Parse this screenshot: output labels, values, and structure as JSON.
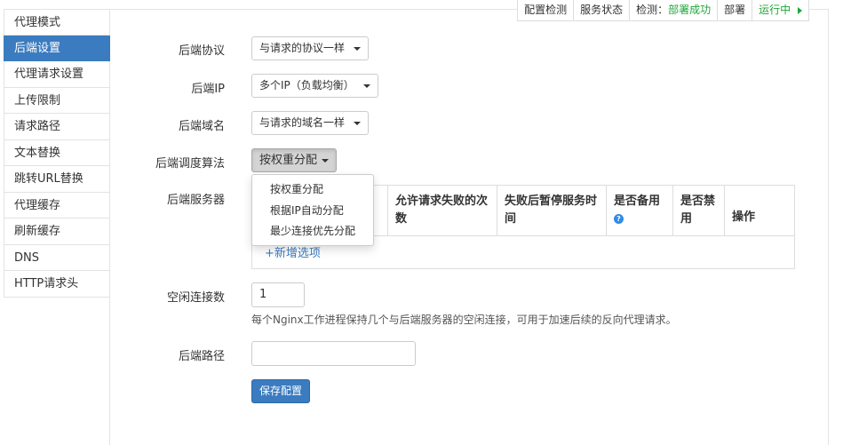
{
  "sidebar": {
    "items": [
      {
        "label": "代理模式"
      },
      {
        "label": "后端设置"
      },
      {
        "label": "代理请求设置"
      },
      {
        "label": "上传限制"
      },
      {
        "label": "请求路径"
      },
      {
        "label": "文本替换"
      },
      {
        "label": "跳转URL替换"
      },
      {
        "label": "代理缓存"
      },
      {
        "label": "刷新缓存"
      },
      {
        "label": "DNS"
      },
      {
        "label": "HTTP请求头"
      }
    ],
    "active_index": 1
  },
  "statusbar": {
    "config_check": "配置检测",
    "service_status": "服务状态",
    "detect_prefix": "检测：",
    "detect_result": "部署成功",
    "deploy": "部署",
    "running": "运行中",
    "running_icon": "caret-right-icon"
  },
  "form": {
    "backend_protocol": {
      "label": "后端协议",
      "value": "与请求的协议一样"
    },
    "backend_ip": {
      "label": "后端IP",
      "value": "多个IP（负载均衡）"
    },
    "backend_domain": {
      "label": "后端域名",
      "value": "与请求的域名一样"
    },
    "scheduling": {
      "label": "后端调度算法",
      "value": "按权重分配",
      "options": [
        "按权重分配",
        "根据IP自动分配",
        "最少连接优先分配"
      ]
    },
    "backend_servers": {
      "label": "后端服务器",
      "columns": [
        "允许请求失败的次数",
        "失败后暂停服务时间",
        "是否备用",
        "是否禁用",
        "操作"
      ],
      "add_option": "+新增选项"
    },
    "idle_connections": {
      "label": "空闲连接数",
      "value": "1",
      "hint": "每个Nginx工作进程保持几个与后端服务器的空闲连接，可用于加速后续的反向代理请求。"
    },
    "backend_path": {
      "label": "后端路径",
      "value": ""
    },
    "save_label": "保存配置"
  },
  "colors": {
    "accent": "#3b7bbf",
    "success": "#20a53a"
  }
}
